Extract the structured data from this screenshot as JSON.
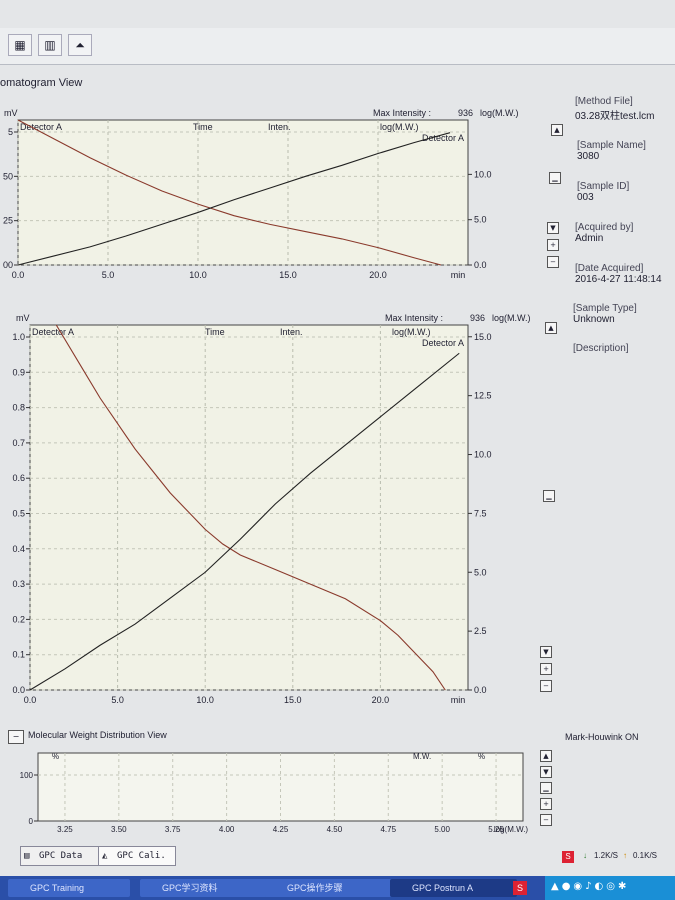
{
  "toolbar": {
    "buttons": [
      {
        "icon": "chromatogram-icon"
      },
      {
        "icon": "bar-chart-icon"
      },
      {
        "icon": "peak-icon"
      }
    ]
  },
  "chromatogram_view": {
    "title": "omatogram View"
  },
  "top_chart": {
    "y_unit": "mV",
    "header_max_intensity": "Max Intensity :",
    "header_max_value": "936",
    "header_logmw": "log(M.W.)",
    "in_plot_detector": "Detector A",
    "in_plot_time": "Time",
    "in_plot_inten": "Inten.",
    "in_plot_logmw": "log(M.W.)",
    "in_plot_detector_right": "Detector A",
    "x_unit": "min",
    "x_ticks": [
      "0.0",
      "5.0",
      "10.0",
      "15.0",
      "20.0"
    ],
    "y_left_ticks": [
      "5",
      "50",
      "25",
      "00"
    ],
    "y_right_ticks": [
      "10.0",
      "5.0",
      "0.0"
    ]
  },
  "bottom_chart": {
    "y_unit": "mV",
    "header_max_intensity": "Max Intensity :",
    "header_max_value": "936",
    "header_logmw": "log(M.W.)",
    "in_plot_detector": "Detector A",
    "in_plot_time": "Time",
    "in_plot_inten": "Inten.",
    "in_plot_logmw": "log(M.W.)",
    "in_plot_detector_right": "Detector A",
    "x_unit": "min",
    "x_ticks": [
      "0.0",
      "5.0",
      "10.0",
      "15.0",
      "20.0"
    ],
    "y_left_ticks": [
      "1.0",
      "0.9",
      "0.8",
      "0.7",
      "0.6",
      "0.5",
      "0.4",
      "0.3",
      "0.2",
      "0.1",
      "0.0"
    ],
    "y_right_ticks": [
      "15.0",
      "12.5",
      "10.0",
      "7.5",
      "5.0",
      "2.5",
      "0.0"
    ]
  },
  "chart_data": [
    {
      "type": "line",
      "xlabel": "min",
      "ylabel": "mV",
      "xlim": [
        0,
        25
      ],
      "ylim_right": [
        0,
        16
      ],
      "series": [
        {
          "name": "Detector A",
          "color": "#8a3a2c",
          "x": [
            0,
            2,
            4,
            6,
            8,
            10,
            12,
            14,
            16,
            18,
            20,
            22,
            23.5
          ],
          "y": [
            1.0,
            0.87,
            0.74,
            0.62,
            0.51,
            0.42,
            0.34,
            0.28,
            0.23,
            0.18,
            0.12,
            0.05,
            0.0
          ]
        },
        {
          "name": "log(M.W.)",
          "color": "#222222",
          "x": [
            0,
            2,
            4,
            6,
            8,
            10,
            12,
            14,
            16,
            18,
            20,
            22,
            24
          ],
          "y": [
            0.0,
            1.0,
            2.0,
            3.2,
            4.5,
            5.8,
            7.2,
            8.5,
            9.8,
            11.0,
            12.3,
            13.5,
            14.6
          ]
        }
      ]
    },
    {
      "type": "line",
      "xlabel": "min",
      "ylabel": "mV",
      "xlim": [
        0,
        25
      ],
      "ylim": [
        0,
        1.0
      ],
      "ylim_right": [
        0,
        15
      ],
      "series": [
        {
          "name": "Detector A",
          "color": "#8a3a2c",
          "x": [
            1.5,
            3,
            4,
            5,
            6,
            7,
            8,
            9,
            10,
            11,
            12,
            14,
            16,
            18,
            20,
            21,
            22,
            23,
            23.7
          ],
          "y": [
            1.0,
            0.88,
            0.8,
            0.73,
            0.66,
            0.6,
            0.54,
            0.49,
            0.44,
            0.4,
            0.37,
            0.33,
            0.29,
            0.25,
            0.19,
            0.15,
            0.1,
            0.05,
            0.0
          ]
        },
        {
          "name": "log(M.W.)",
          "color": "#222222",
          "x": [
            0,
            2,
            4,
            6,
            8,
            10,
            11,
            12,
            14,
            16,
            18,
            20,
            22,
            24.5
          ],
          "y": [
            0.0,
            0.9,
            1.9,
            2.8,
            3.9,
            5.0,
            5.7,
            6.4,
            7.9,
            9.2,
            10.4,
            11.6,
            12.8,
            14.3
          ]
        }
      ]
    },
    {
      "type": "line",
      "xlabel": "log(M.W.)",
      "ylabel": "%",
      "xlim": [
        3.125,
        5.375
      ],
      "ylim": [
        0,
        100
      ],
      "x_ticks": [
        "3.25",
        "3.50",
        "3.75",
        "4.00",
        "4.25",
        "4.50",
        "4.75",
        "5.00",
        "5.25"
      ],
      "series": []
    }
  ],
  "info_panel": {
    "method_file_label": "[Method File]",
    "method_file_value": "03.28双柱test.lcm",
    "sample_name_label": "[Sample Name]",
    "sample_name_value": "3080",
    "sample_id_label": "[Sample ID]",
    "sample_id_value": "003",
    "acquired_by_label": "[Acquired by]",
    "acquired_by_value": "Admin",
    "date_acquired_label": "[Date Acquired]",
    "date_acquired_value": "2016-4-27 11:48:14",
    "sample_type_label": "[Sample Type]",
    "sample_type_value": "Unknown",
    "description_label": "[Description]"
  },
  "mw_view": {
    "title": "Molecular Weight Distribution View",
    "mark_houwink": "Mark-Houwink ON",
    "y_unit": "%",
    "header_mw": "M.W.",
    "header_pct": "%",
    "y_ticks": [
      "100",
      "0"
    ],
    "x_unit": "log(M.W.)",
    "x_ticks": [
      "3.25",
      "3.50",
      "3.75",
      "4.00",
      "4.25",
      "4.50",
      "4.75",
      "5.00",
      "5.25"
    ]
  },
  "tabs": [
    {
      "label": "GPC Data"
    },
    {
      "label": "GPC Cali."
    }
  ],
  "status": {
    "down_rate": "1.2K/S",
    "up_rate": "0.1K/S"
  },
  "taskbar": {
    "items": [
      {
        "label": "GPC Training"
      },
      {
        "label": "GPC学习资料"
      },
      {
        "label": "GPC操作步骤"
      },
      {
        "label": "GPC Postrun A"
      }
    ]
  }
}
